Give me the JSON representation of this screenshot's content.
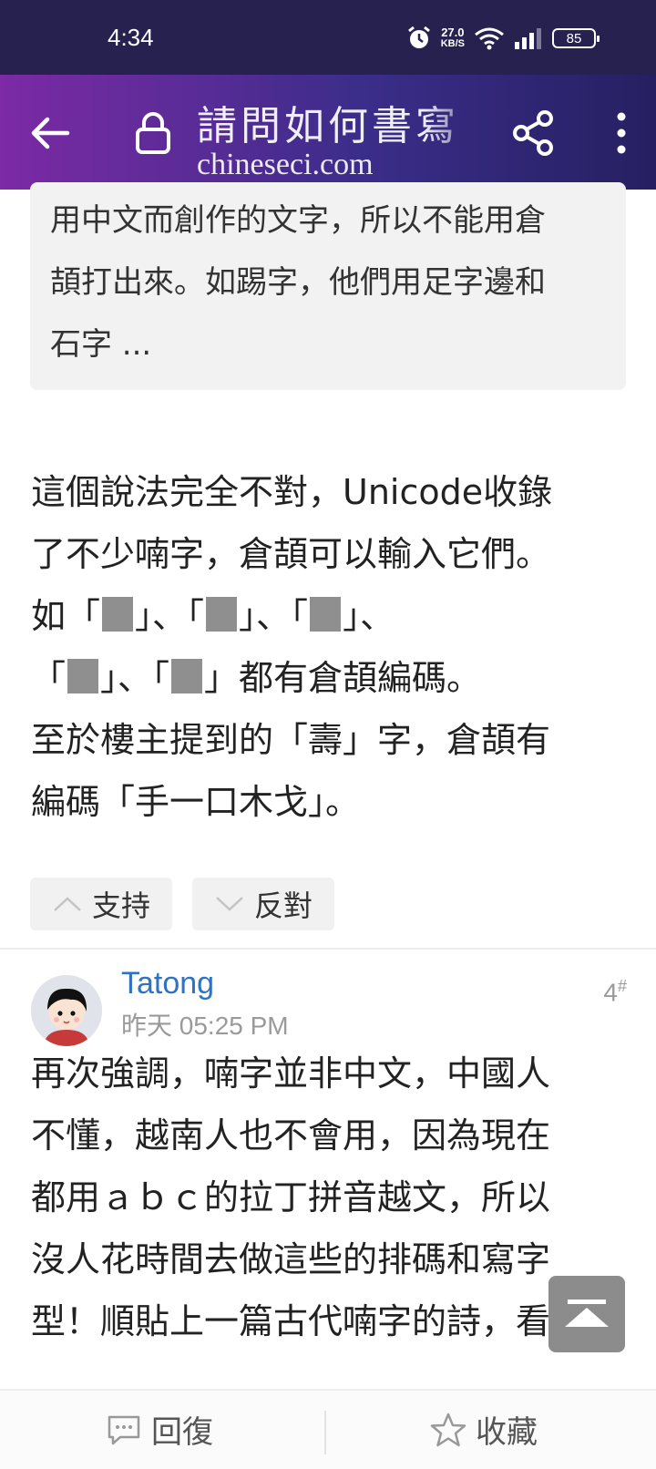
{
  "status_bar": {
    "time": "4:34",
    "net_speed_value": "27.0",
    "net_speed_unit": "KB/S",
    "battery": "85",
    "icons": [
      "alarm-icon",
      "wifi-icon",
      "signal-icon",
      "battery-icon"
    ]
  },
  "toolbar": {
    "title": "請問如何書寫",
    "domain": "chineseci.com",
    "icons": [
      "back-arrow-icon",
      "lock-icon",
      "share-icon",
      "more-vertical-icon"
    ]
  },
  "quote": {
    "lines": [
      "用中文而創作的文字，所以不能用倉",
      "頡打出來。如踢字，他們用足字邊和",
      "石字 ..."
    ]
  },
  "post1": {
    "line1": "這個說法完全不對，Unicode收錄",
    "line2": "了不少喃字，倉頡可以輸入它們。",
    "line3_prefix": "如",
    "line5": "都有倉頡編碼。",
    "line6": "至於樓主提到的「壽」字，倉頡有",
    "line7": "編碼「手一口木戈」。"
  },
  "votes": {
    "support": "支持",
    "oppose": "反對"
  },
  "post2": {
    "author": "Tatong",
    "time": "昨天 05:25 PM",
    "floor": "4",
    "floor_mark": "#",
    "lines": [
      "再次強調，喃字並非中文，中國人",
      "不懂，越南人也不會用，因為現在",
      "都用ａｂｃ的拉丁拼音越文，所以",
      "沒人花時間去做這些的排碼和寫字",
      "型！順貼上一篇古代喃字的詩，看"
    ]
  },
  "bottom_bar": {
    "reply": "回復",
    "favorite": "收藏"
  },
  "colors": {
    "status_bg": "#26214f",
    "toolbar_gradient_start": "#7c2aa5",
    "toolbar_gradient_end": "#262061",
    "author_link": "#2f72c2"
  }
}
